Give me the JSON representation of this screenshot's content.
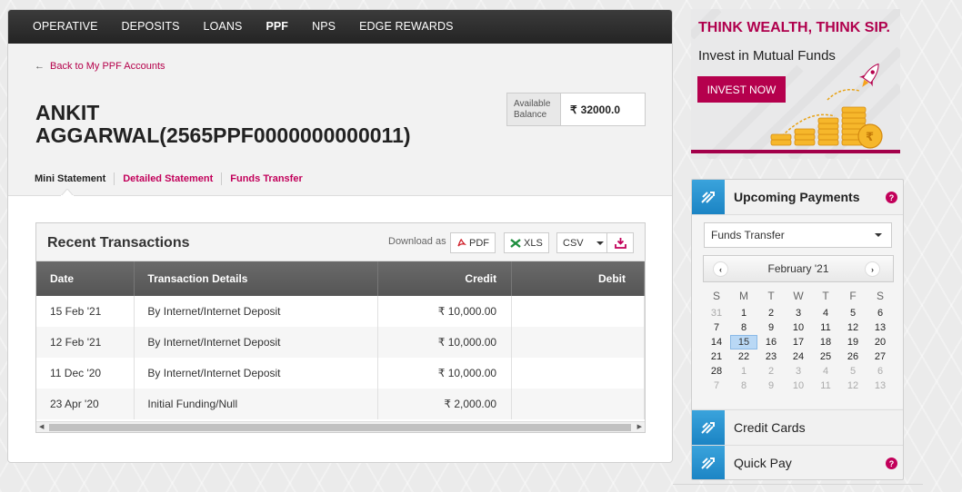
{
  "nav": {
    "items": [
      "OPERATIVE",
      "DEPOSITS",
      "LOANS",
      "PPF",
      "NPS",
      "EDGE REWARDS"
    ],
    "active": "PPF"
  },
  "back_link": "Back to My PPF Accounts",
  "account": {
    "name_line1": "ANKIT",
    "name_line2": "AGGARWAL(2565PPF0000000000011)"
  },
  "balance": {
    "label_line1": "Available",
    "label_line2": "Balance",
    "currency": "₹",
    "value": "32000.0"
  },
  "subtabs": [
    "Mini Statement",
    "Detailed Statement",
    "Funds Transfer"
  ],
  "transactions": {
    "title": "Recent Transactions",
    "download_as": "Download as",
    "pdf_label": "PDF",
    "xls_label": "XLS",
    "csv_value": "CSV",
    "columns": [
      "Date",
      "Transaction Details",
      "Credit",
      "Debit"
    ],
    "rows": [
      {
        "date": "15 Feb '21",
        "details": "By Internet/Internet Deposit",
        "credit": "₹ 10,000.00",
        "debit": ""
      },
      {
        "date": "12 Feb '21",
        "details": "By Internet/Internet Deposit",
        "credit": "₹ 10,000.00",
        "debit": ""
      },
      {
        "date": "11 Dec '20",
        "details": "By Internet/Internet Deposit",
        "credit": "₹ 10,000.00",
        "debit": ""
      },
      {
        "date": "23 Apr '20",
        "details": "Initial Funding/Null",
        "credit": "₹ 2,000.00",
        "debit": ""
      }
    ]
  },
  "ad": {
    "headline": "THINK WEALTH, THINK SIP.",
    "subline": "Invest in Mutual Funds",
    "button": "INVEST NOW"
  },
  "widget": {
    "upcoming_payments": "Upcoming Payments",
    "payee_select": "Funds Transfer",
    "calendar": {
      "month": "February '21",
      "dow": [
        "S",
        "M",
        "T",
        "W",
        "T",
        "F",
        "S"
      ],
      "weeks": [
        [
          "31",
          "1",
          "2",
          "3",
          "4",
          "5",
          "6"
        ],
        [
          "7",
          "8",
          "9",
          "10",
          "11",
          "12",
          "13"
        ],
        [
          "14",
          "15",
          "16",
          "17",
          "18",
          "19",
          "20"
        ],
        [
          "21",
          "22",
          "23",
          "24",
          "25",
          "26",
          "27"
        ],
        [
          "28",
          "1",
          "2",
          "3",
          "4",
          "5",
          "6"
        ],
        [
          "7",
          "8",
          "9",
          "10",
          "11",
          "12",
          "13"
        ]
      ],
      "today": "15"
    },
    "credit_cards": "Credit Cards",
    "quick_pay": "Quick Pay",
    "help_symbol": "?"
  },
  "colors": {
    "accent": "#b5004d",
    "nav_bg": "#2f2f2f",
    "widget_icon": "#2894d2"
  }
}
